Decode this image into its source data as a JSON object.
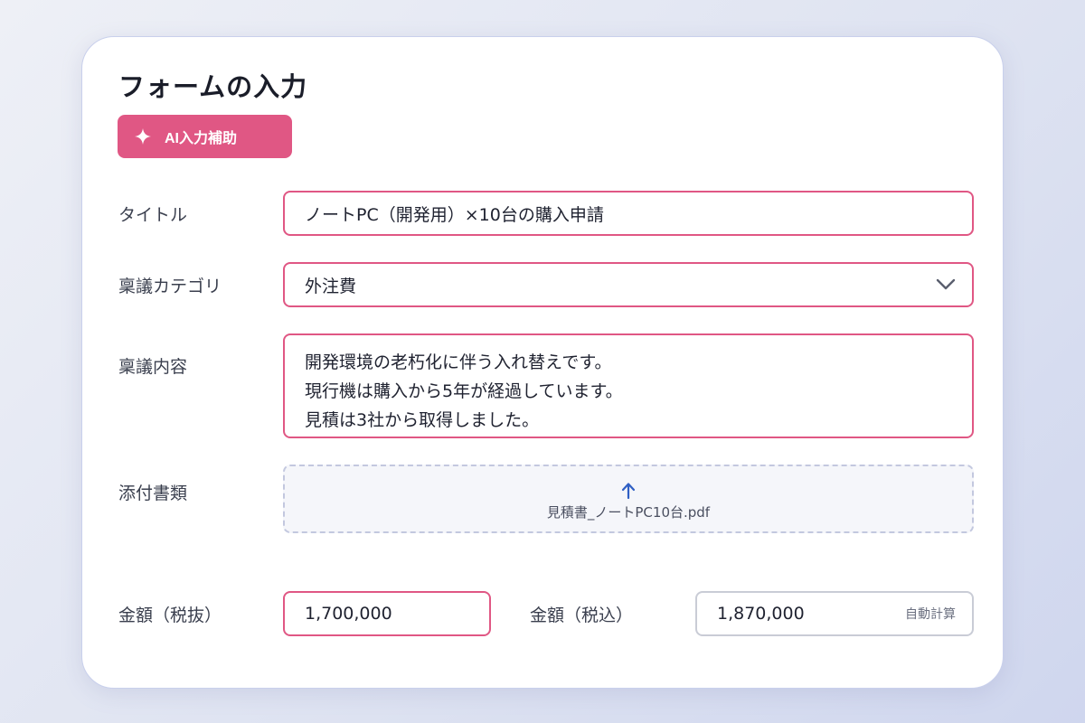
{
  "form": {
    "title": "フォームの入力",
    "ai_button_label": "AI入力補助",
    "title_label": "タイトル",
    "title_value": "ノートPC（開発用）×10台の購入申請",
    "category_label": "稟議カテゴリ",
    "category_value": "外注費",
    "content_label": "稟議内容",
    "content_lines": [
      "開発環境の老朽化に伴う入れ替えです。",
      "現行機は購入から5年が経過しています。",
      "見積は3社から取得しました。"
    ],
    "attachment_label": "添付書類",
    "attachment_file": "見積書_ノートPC10台.pdf",
    "amount_pre_label": "金額（税抜）",
    "amount_pre_value": "1,700,000",
    "amount_post_label": "金額（税込）",
    "amount_post_value": "1,870,000",
    "auto_calc_label": "自動計算"
  },
  "colors": {
    "accent": "#e05784",
    "upload_arrow": "#2f5fc4"
  },
  "icons": {
    "ai_button": "sparkle-icon",
    "category": "chevron-down-icon",
    "upload": "upload-arrow-icon"
  }
}
